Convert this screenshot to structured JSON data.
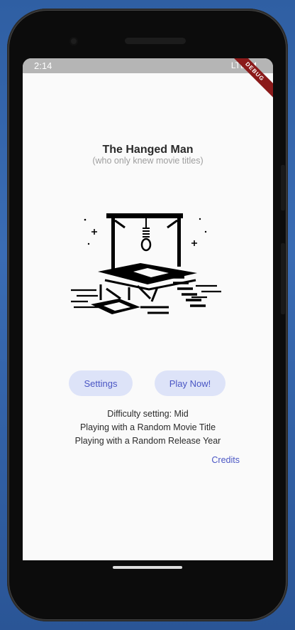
{
  "status_bar": {
    "time": "2:14",
    "network": "LTE",
    "debug_label": "DEBUG"
  },
  "header": {
    "title": "The Hanged Man",
    "subtitle": "(who only knew movie titles)"
  },
  "illustration": {
    "icon": "gallows-icon"
  },
  "actions": {
    "settings_label": "Settings",
    "play_label": "Play Now!"
  },
  "info": {
    "difficulty": "Difficulty setting: Mid",
    "title_mode": "Playing with a Random Movie Title",
    "year_mode": "Playing with a Random Release Year"
  },
  "credits_label": "Credits",
  "colors": {
    "accent": "#4a56c4",
    "button_bg": "#dde3f8",
    "background": "#fafafa",
    "status_bar": "#b5b5b5"
  }
}
